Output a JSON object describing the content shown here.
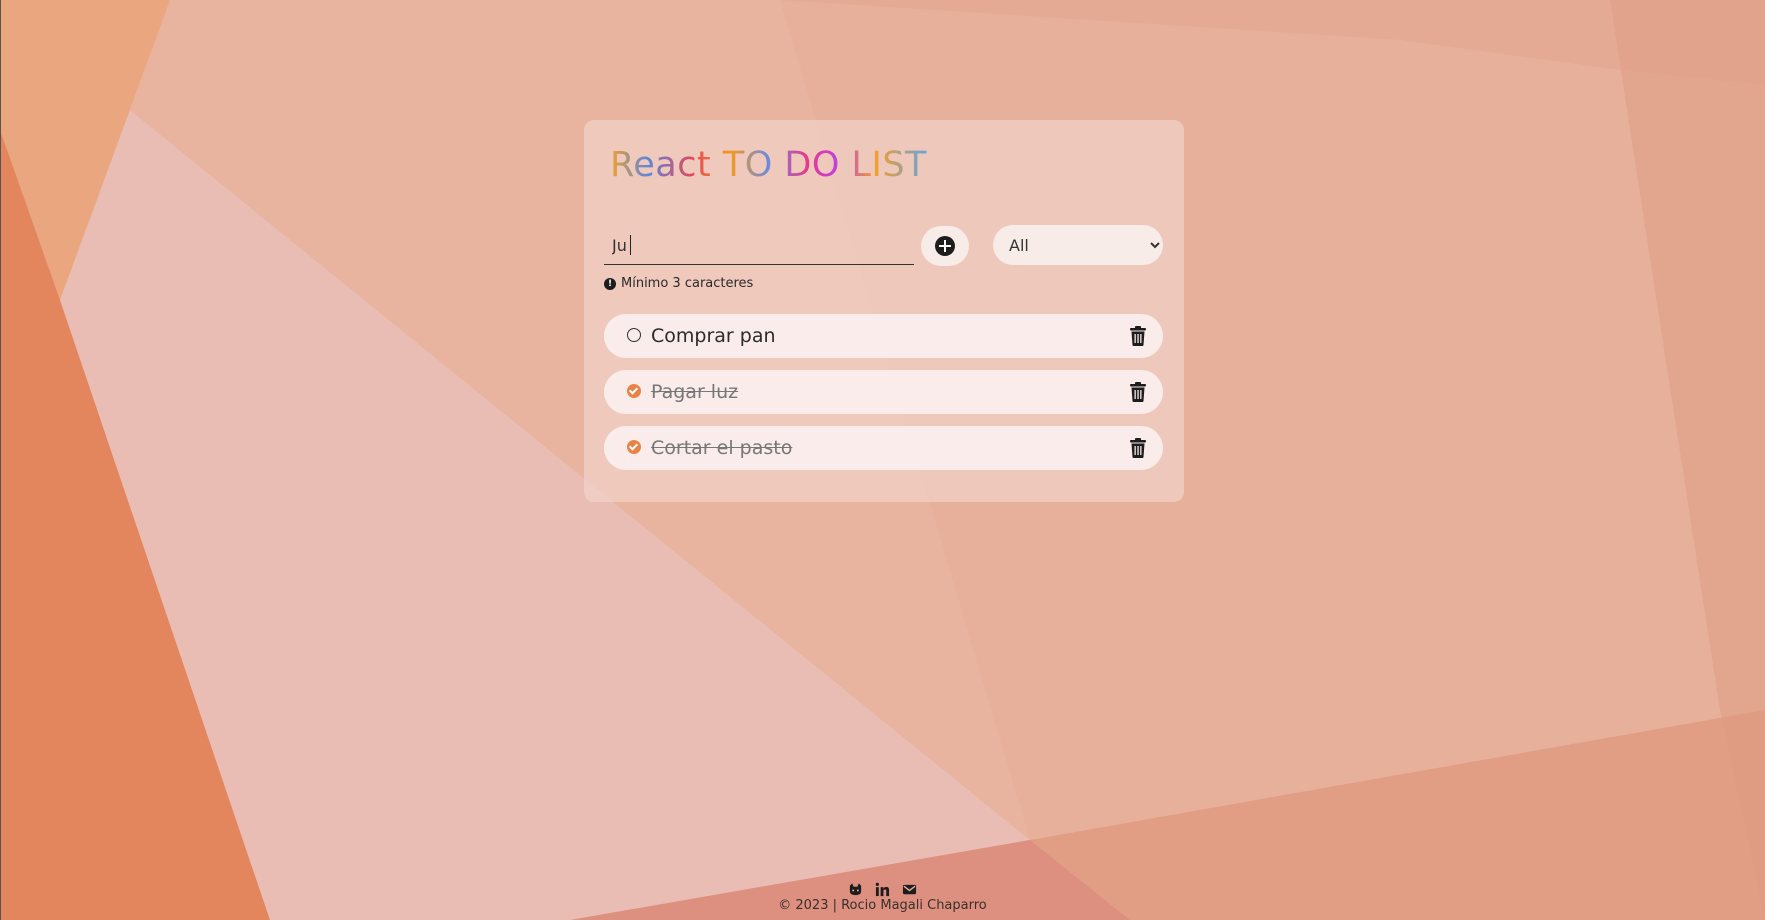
{
  "app": {
    "title": "React TO DO LIST"
  },
  "form": {
    "input_value": "Ju",
    "add_icon": "plus-circle-icon",
    "filter_options": [
      "All"
    ],
    "filter_selected": "All"
  },
  "validation": {
    "icon": "exclamation-circle-icon",
    "message": "Mínimo 3 caracteres"
  },
  "todos": [
    {
      "label": "Comprar pan",
      "done": false,
      "delete_icon": "trash-icon"
    },
    {
      "label": "Pagar luz",
      "done": true,
      "delete_icon": "trash-icon"
    },
    {
      "label": "Cortar el pasto",
      "done": true,
      "delete_icon": "trash-icon"
    }
  ],
  "footer": {
    "icons": [
      "github-icon",
      "linkedin-icon",
      "mail-icon"
    ],
    "copyright": "© 2023 | Rocio Magali Chaparro"
  },
  "colors": {
    "accent": "#e88345",
    "card": "#f2d6ce",
    "pill": "#f9ecea"
  }
}
